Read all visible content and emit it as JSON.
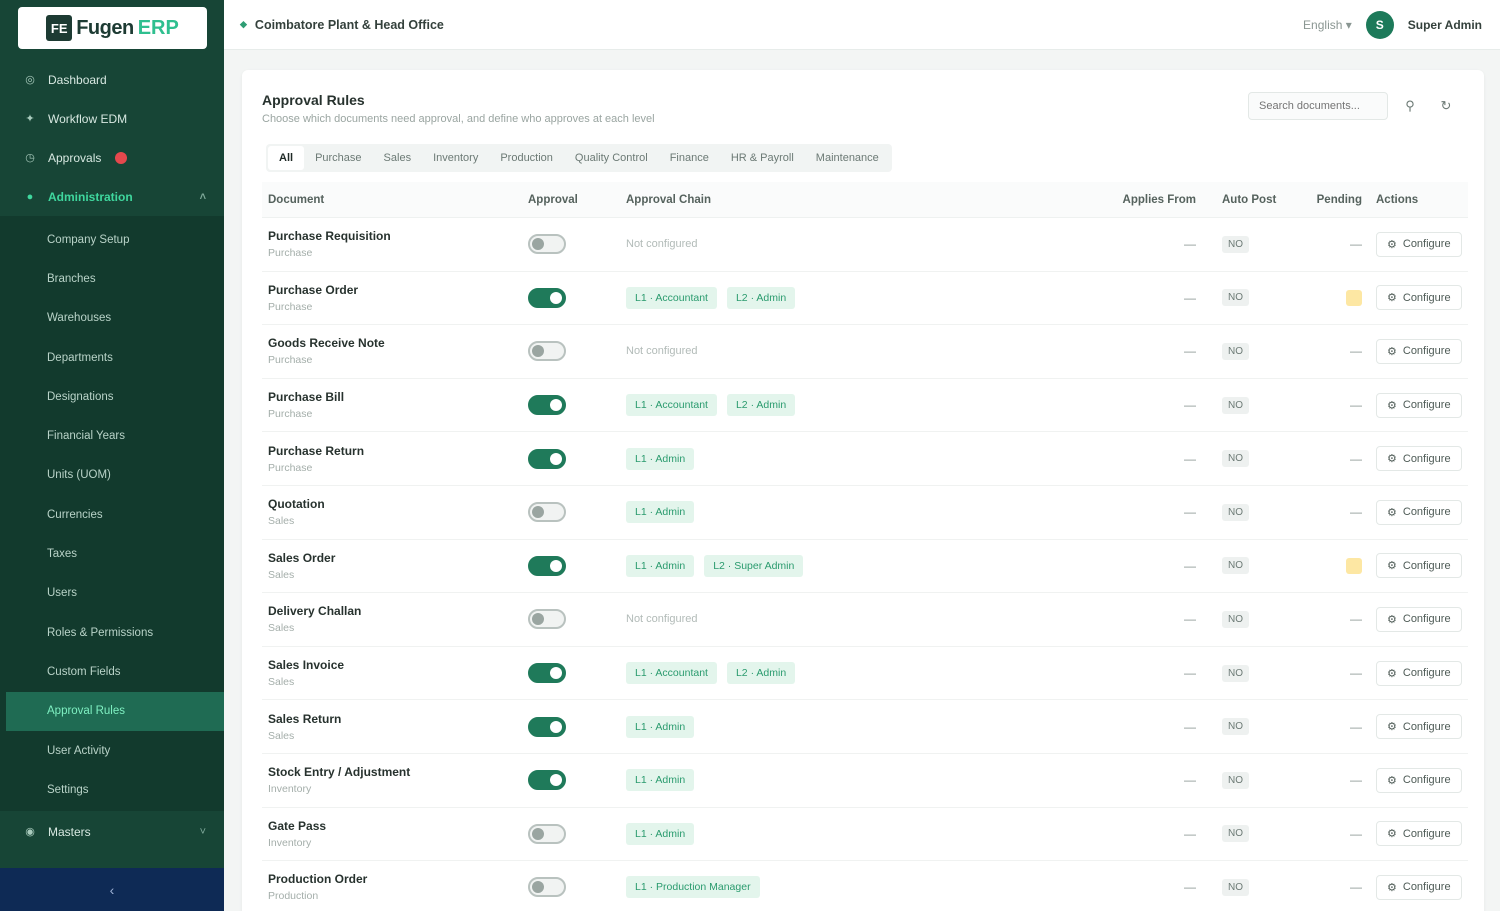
{
  "brand": {
    "mark": "FE",
    "name": "Fugen",
    "accent": "ERP"
  },
  "sidebar": {
    "top_items": [
      {
        "label": "Dashboard",
        "icon": "dashboard-icon",
        "glyph": "◎"
      },
      {
        "label": "Workflow EDM",
        "icon": "workflow-icon",
        "glyph": "✦"
      },
      {
        "label": "Approvals",
        "icon": "approval-icon",
        "glyph": "◷",
        "badge": true
      },
      {
        "label": "Administration",
        "icon": "admin-icon",
        "glyph": "●",
        "active": true
      }
    ],
    "sub_items": [
      "Company Setup",
      "Branches",
      "Warehouses",
      "Departments",
      "Designations",
      "Financial Years",
      "Units (UOM)",
      "Currencies",
      "Taxes",
      "Users",
      "Roles & Permissions",
      "Custom Fields",
      "Approval Rules",
      "User Activity",
      "Settings"
    ],
    "current_sub": "Approval Rules",
    "bottom_items": [
      {
        "label": "Masters",
        "icon": "masters-icon",
        "glyph": "◉"
      }
    ],
    "collapse_glyph": "‹"
  },
  "topbar": {
    "org": "Coimbatore Plant & Head Office",
    "lang": "English ▾",
    "avatar": "S",
    "user": "Super Admin"
  },
  "page": {
    "title": "Approval Rules",
    "subtitle": "Choose which documents need approval, and define who approves at each level",
    "search_placeholder": "Search documents..."
  },
  "tabs": [
    "All",
    "Purchase",
    "Sales",
    "Inventory",
    "Production",
    "Quality Control",
    "Finance",
    "HR & Payroll",
    "Maintenance"
  ],
  "columns": {
    "document": "Document",
    "approval": "Approval",
    "chain": "Approval Chain",
    "from": "Applies From",
    "auto": "Auto Post",
    "pending": "Pending",
    "actions": "Actions"
  },
  "not_configured": "Not configured",
  "dash": "—",
  "auto_value": "NO",
  "configure_label": "Configure",
  "rows": [
    {
      "name": "Purchase Requisition",
      "module": "Purchase",
      "on": false,
      "chain": [],
      "pending_warn": false
    },
    {
      "name": "Purchase Order",
      "module": "Purchase",
      "on": true,
      "chain": [
        "L1 · Accountant",
        "L2 · Admin"
      ],
      "pending_warn": true
    },
    {
      "name": "Goods Receive Note",
      "module": "Purchase",
      "on": false,
      "chain": [],
      "pending_warn": false
    },
    {
      "name": "Purchase Bill",
      "module": "Purchase",
      "on": true,
      "chain": [
        "L1 · Accountant",
        "L2 · Admin"
      ],
      "pending_warn": false
    },
    {
      "name": "Purchase Return",
      "module": "Purchase",
      "on": true,
      "chain": [
        "L1 · Admin"
      ],
      "pending_warn": false
    },
    {
      "name": "Quotation",
      "module": "Sales",
      "on": false,
      "chain": [
        "L1 · Admin"
      ],
      "pending_warn": false
    },
    {
      "name": "Sales Order",
      "module": "Sales",
      "on": true,
      "chain": [
        "L1 · Admin",
        "L2 · Super Admin"
      ],
      "pending_warn": true
    },
    {
      "name": "Delivery Challan",
      "module": "Sales",
      "on": false,
      "chain": [],
      "pending_warn": false
    },
    {
      "name": "Sales Invoice",
      "module": "Sales",
      "on": true,
      "chain": [
        "L1 · Accountant",
        "L2 · Admin"
      ],
      "pending_warn": false
    },
    {
      "name": "Sales Return",
      "module": "Sales",
      "on": true,
      "chain": [
        "L1 · Admin"
      ],
      "pending_warn": false
    },
    {
      "name": "Stock Entry / Adjustment",
      "module": "Inventory",
      "on": true,
      "chain": [
        "L1 · Admin"
      ],
      "pending_warn": false
    },
    {
      "name": "Gate Pass",
      "module": "Inventory",
      "on": false,
      "chain": [
        "L1 · Admin"
      ],
      "pending_warn": false
    },
    {
      "name": "Production Order",
      "module": "Production",
      "on": false,
      "chain": [
        "L1 · Production Manager"
      ],
      "pending_warn": false
    }
  ]
}
